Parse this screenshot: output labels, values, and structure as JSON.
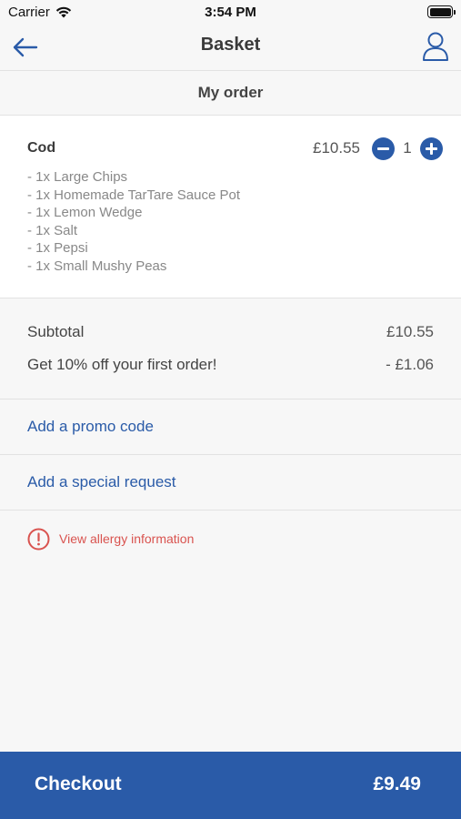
{
  "status_bar": {
    "carrier": "Carrier",
    "time": "3:54 PM",
    "icons": [
      "wifi-icon",
      "battery-icon"
    ]
  },
  "nav": {
    "title": "Basket",
    "back_icon": "arrow-left-icon",
    "account_icon": "user-icon"
  },
  "section": {
    "title": "My order"
  },
  "order": {
    "items": [
      {
        "name": "Cod",
        "price": "£10.55",
        "quantity": "1",
        "addons": [
          "- 1x Large Chips",
          "- 1x Homemade TarTare Sauce Pot",
          "- 1x Lemon Wedge",
          "- 1x Salt",
          "- 1x Pepsi",
          "- 1x Small Mushy Peas"
        ]
      }
    ]
  },
  "totals": {
    "subtotal_label": "Subtotal",
    "subtotal_value": "£10.55",
    "discount_label": "Get 10% off your first order!",
    "discount_value": "- £1.06"
  },
  "links": {
    "promo": "Add a promo code",
    "special_request": "Add a special request"
  },
  "allergy": {
    "label": "View allergy information",
    "icon": "alert-circle-icon"
  },
  "checkout": {
    "label": "Checkout",
    "total": "£9.49"
  },
  "colors": {
    "accent": "#2a5ba8",
    "warning": "#d9534f",
    "background": "#f7f7f7"
  }
}
